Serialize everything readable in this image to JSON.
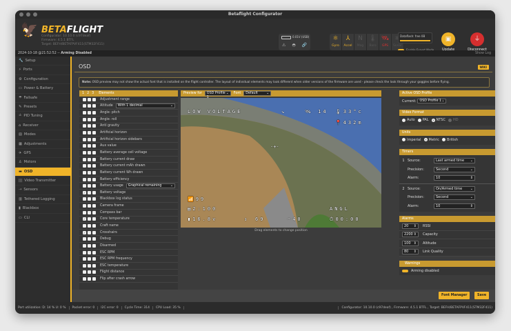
{
  "window": {
    "title": "Betaflight Configurator"
  },
  "header": {
    "brand_a": "BETA",
    "brand_b": "FLIGHT",
    "configurator": "Configurator: 10.10.0 (c97deaf)",
    "firmware": "Firmware: 4.5.1 BTFL",
    "target": "Target: BEFH/BETAFPVF411(STM32F411)",
    "battery": "0.01V (USB)",
    "sensors": [
      {
        "label": "Gyro",
        "icon": "gyro-icon",
        "glyph": "⚛",
        "state": "on"
      },
      {
        "label": "Accel",
        "icon": "accel-icon",
        "glyph": "⅄",
        "state": "on"
      },
      {
        "label": "Mag",
        "icon": "mag-icon",
        "glyph": "N",
        "state": "off"
      },
      {
        "label": "Baro",
        "icon": "baro-icon",
        "glyph": "🌡",
        "state": "off"
      },
      {
        "label": "GPS",
        "icon": "gps-icon",
        "glyph": "🛰",
        "state": "error"
      },
      {
        "label": "Sonar",
        "icon": "sonar-icon",
        "glyph": "≋",
        "state": "off"
      }
    ],
    "dataflash": "Dataflash: free 0B",
    "expert_mode": "Enable Expert Mode",
    "update_firmware": "Update Firmware",
    "disconnect": "Disconnect"
  },
  "status": {
    "text": "2024-10-18 @21:52:52 -- ",
    "bold": "Arming Disabled",
    "show_log": "Show Log"
  },
  "sidebar": {
    "active": "OSD",
    "items": [
      {
        "label": "Setup",
        "glyph": "🔧"
      },
      {
        "label": "Ports",
        "glyph": "⚡"
      },
      {
        "label": "Configuration",
        "glyph": "⚙"
      },
      {
        "label": "Power & Battery",
        "glyph": "▭"
      },
      {
        "label": "Failsafe",
        "glyph": "☂"
      },
      {
        "label": "Presets",
        "glyph": "✎"
      },
      {
        "label": "PID Tuning",
        "glyph": "≟"
      },
      {
        "label": "Receiver",
        "glyph": "⌂"
      },
      {
        "label": "Modes",
        "glyph": "▤"
      },
      {
        "label": "Adjustments",
        "glyph": "▦"
      },
      {
        "label": "GPS",
        "glyph": "✈"
      },
      {
        "label": "Motors",
        "glyph": "♙"
      },
      {
        "label": "OSD",
        "glyph": "▬"
      },
      {
        "label": "Video Transmitter",
        "glyph": "|||"
      },
      {
        "label": "Sensors",
        "glyph": "⇢"
      },
      {
        "label": "Tethered Logging",
        "glyph": "▥"
      },
      {
        "label": "Blackbox",
        "glyph": "▮"
      },
      {
        "label": "CLI",
        "glyph": "▭"
      }
    ]
  },
  "page": {
    "title": "OSD",
    "wiki": "WIKI",
    "note_bold": "Note:",
    "note": " OSD preview may not show the actual font that is installed on the flight controller. The layout of individual elements may look different when older versions of the firmware are used - please check the look through your goggles before flying."
  },
  "elements": {
    "profiles": [
      "1",
      "2",
      "3"
    ],
    "header": "Elements",
    "items": [
      {
        "label": "Adjustment range",
        "checked": [
          false,
          false,
          false
        ]
      },
      {
        "label": "Altitude",
        "checked": [
          false,
          false,
          false
        ],
        "select": "With 1 decimal"
      },
      {
        "label": "Angle: pitch",
        "checked": [
          false,
          false,
          false
        ]
      },
      {
        "label": "Angle: roll",
        "checked": [
          false,
          false,
          false
        ]
      },
      {
        "label": "Anti gravity",
        "checked": [
          false,
          false,
          false
        ]
      },
      {
        "label": "Artificial horizon",
        "checked": [
          false,
          false,
          false
        ]
      },
      {
        "label": "Artificial horizon sidebars",
        "checked": [
          false,
          false,
          false
        ]
      },
      {
        "label": "Aux value",
        "checked": [
          false,
          false,
          false
        ]
      },
      {
        "label": "Battery average cell voltage",
        "checked": [
          false,
          false,
          false
        ]
      },
      {
        "label": "Battery current draw",
        "checked": [
          false,
          false,
          false
        ]
      },
      {
        "label": "Battery current mAh drawn",
        "checked": [
          false,
          false,
          false
        ]
      },
      {
        "label": "Battery current Wh drawn",
        "checked": [
          false,
          false,
          false
        ]
      },
      {
        "label": "Battery efficiency",
        "checked": [
          false,
          false,
          false
        ]
      },
      {
        "label": "Battery usage",
        "checked": [
          false,
          false,
          false
        ],
        "select": "Graphical remaining"
      },
      {
        "label": "Battery voltage",
        "checked": [
          true,
          false,
          false
        ]
      },
      {
        "label": "Blackbox log status",
        "checked": [
          false,
          false,
          false
        ]
      },
      {
        "label": "Camera frame",
        "checked": [
          false,
          false,
          false
        ]
      },
      {
        "label": "Compass bar",
        "checked": [
          false,
          false,
          false
        ]
      },
      {
        "label": "Core temperature",
        "checked": [
          true,
          false,
          false
        ]
      },
      {
        "label": "Craft name",
        "checked": [
          false,
          false,
          false
        ]
      },
      {
        "label": "Crosshairs",
        "checked": [
          true,
          false,
          false
        ]
      },
      {
        "label": "Debug",
        "checked": [
          false,
          false,
          false
        ]
      },
      {
        "label": "Disarmed",
        "checked": [
          false,
          false,
          false
        ]
      },
      {
        "label": "ESC RPM",
        "checked": [
          false,
          false,
          false
        ]
      },
      {
        "label": "ESC RPM frequency",
        "checked": [
          false,
          false,
          false
        ]
      },
      {
        "label": "ESC temperature",
        "checked": [
          false,
          false,
          false
        ]
      },
      {
        "label": "Flight distance",
        "checked": [
          false,
          false,
          false
        ]
      },
      {
        "label": "Flip after crash arrow",
        "checked": [
          false,
          false,
          false
        ]
      }
    ]
  },
  "preview": {
    "preview_for": "Preview for",
    "profile": "OSD Profile 1",
    "font_label": "Font",
    "font": "Default",
    "caption": "Drag elements to change position",
    "osd": {
      "warning": "LOW VOLTAGE",
      "arrow": "↘",
      "sats": "14",
      "temp": "33°c",
      "alt": "432m",
      "rssi": "99",
      "capacity": "2:100",
      "voltage": "16.8v",
      "throttle": "69",
      "speed": "40",
      "mode": "ANGL",
      "timer": "00:00"
    }
  },
  "right": {
    "active_profile": {
      "title": "Active OSD Profile",
      "current_label": "Current:",
      "current": "OSD Profile 1"
    },
    "video_format": {
      "title": "Video Format",
      "options": [
        {
          "label": "Auto",
          "enabled": true
        },
        {
          "label": "PAL",
          "enabled": true
        },
        {
          "label": "NTSC",
          "enabled": true,
          "selected": true
        },
        {
          "label": "HD",
          "enabled": false
        }
      ]
    },
    "units": {
      "title": "Units",
      "options": [
        {
          "label": "Imperial"
        },
        {
          "label": "Metric",
          "selected": true
        },
        {
          "label": "British"
        }
      ]
    },
    "timers": {
      "title": "Timers",
      "source_label": "Source:",
      "precision_label": "Precision:",
      "alarm_label": "Alarm:",
      "items": [
        {
          "n": "1",
          "source": "Last armed time",
          "precision": "Second",
          "alarm": "10"
        },
        {
          "n": "2",
          "source": "On/Armed time",
          "precision": "Second",
          "alarm": "10"
        }
      ]
    },
    "alarms": {
      "title": "Alarms",
      "items": [
        {
          "value": "20",
          "label": "RSSI"
        },
        {
          "value": "2200",
          "label": "Capacity"
        },
        {
          "value": "100",
          "label": "Altitude"
        },
        {
          "value": "80",
          "label": "Link Quality"
        }
      ]
    },
    "warnings": {
      "title": "Warnings",
      "items": [
        {
          "label": "Arming disabled",
          "on": true
        }
      ]
    }
  },
  "buttons": {
    "font_manager": "Font Manager",
    "save": "Save"
  },
  "footer": {
    "port": "Port utilization: D: 14 % U: 0 %",
    "packet": "Packet error: 0",
    "i2c": "I2C error: 0",
    "cycle": "Cycle Time: 314",
    "cpu": "CPU Load: 35 %",
    "version": "Configurator: 10.10.0 (c97deaf) , Firmware: 4.5.1 BTFL , Target: BEFH/BETAFPVF411(STM32F411)"
  },
  "colors": {
    "accent": "#f0b429",
    "error": "#e03030"
  }
}
